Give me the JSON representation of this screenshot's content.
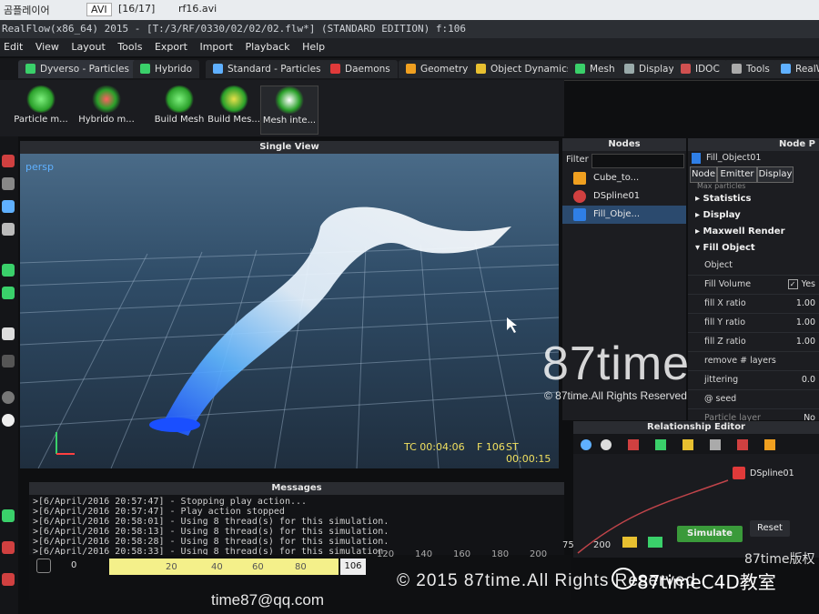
{
  "topbar": {
    "player": "곰플레이어",
    "format": "AVI",
    "counter": "[16/17]",
    "file": "rf16.avi"
  },
  "title": {
    "text": "RealFlow(x86_64) 2015 - [T:/3/RF/0330/02/02/02.flw*] (STANDARD EDITION) f:106"
  },
  "menu": [
    "Edit",
    "View",
    "Layout",
    "Tools",
    "Export",
    "Import",
    "Playback",
    "Help"
  ],
  "tabs": [
    "Dyverso - Particles",
    "Hybrido",
    "Standard - Particles",
    "Daemons",
    "Geometry",
    "Object Dynamics",
    "Mesh",
    "Display",
    "IDOC",
    "Tools",
    "RealWave"
  ],
  "tools": [
    "Particle m...",
    "Hybrido m...",
    "Build Mesh",
    "Build Mes...",
    "Mesh inte..."
  ],
  "viewport": {
    "title": "Single View",
    "camera": "persp",
    "tc": "TC 00:04:06",
    "frame": "F 106",
    "st": "ST 00:00:15"
  },
  "nodes": {
    "title": "Nodes",
    "filter_label": "Filter",
    "filter_value": "",
    "items": [
      "Cube_to...",
      "DSpline01",
      "Fill_Obje..."
    ]
  },
  "node_params": {
    "title": "Node P",
    "object_name": "Fill_Object01",
    "tabs": [
      "Node",
      "Emitter",
      "Display"
    ],
    "hidden_row": "Max particles",
    "sections": [
      "Statistics",
      "Display",
      "Maxwell Render",
      "Fill Object"
    ],
    "rows": [
      {
        "label": "Object",
        "value": ""
      },
      {
        "label": "Fill Volume",
        "value": "Yes"
      },
      {
        "label": "fill X ratio",
        "value": "1.00"
      },
      {
        "label": "fill Y ratio",
        "value": "1.00"
      },
      {
        "label": "fill Z ratio",
        "value": "1.00"
      },
      {
        "label": "remove # layers",
        "value": ""
      },
      {
        "label": "jittering",
        "value": "0.0"
      },
      {
        "label": "@ seed",
        "value": ""
      },
      {
        "label": "Particle layer",
        "value": "No"
      }
    ]
  },
  "relationship": {
    "title": "Relationship Editor",
    "node": "DSpline01"
  },
  "messages": {
    "title": "Messages",
    "lines": [
      ">[6/April/2016 20:57:47] - Stopping play action...",
      ">[6/April/2016 20:57:47] - Play action stopped",
      ">[6/April/2016 20:58:01] - Using 8 thread(s) for this simulation.",
      ">[6/April/2016 20:58:13] - Using 8 thread(s) for this simulation.",
      ">[6/April/2016 20:58:28] - Using 8 thread(s) for this simulation.",
      ">[6/April/2016 20:58:33] - Using 8 thread(s) for this simulation."
    ]
  },
  "timeline": {
    "start": "0",
    "marks": [
      "20",
      "40",
      "60",
      "80"
    ],
    "current": "106",
    "ticks": [
      "120",
      "140",
      "160",
      "180",
      "200"
    ],
    "end_field": "75",
    "max_field": "200"
  },
  "sim": {
    "simulate": "Simulate",
    "reset": "Reset"
  },
  "watermark": {
    "brand": "87time",
    "rights": "© 87time.All Rights Reserved",
    "bottom": "© 2015 87time.All Rights Reserved",
    "email": "time87@qq.com",
    "channel": "87timeC4D教室",
    "corner": "87time版权"
  },
  "colors": {
    "accent": "#2f7fe6",
    "sim_button": "#3a9a3a",
    "timeline_bar": "#f4f08a",
    "particles": "#ffffff"
  }
}
